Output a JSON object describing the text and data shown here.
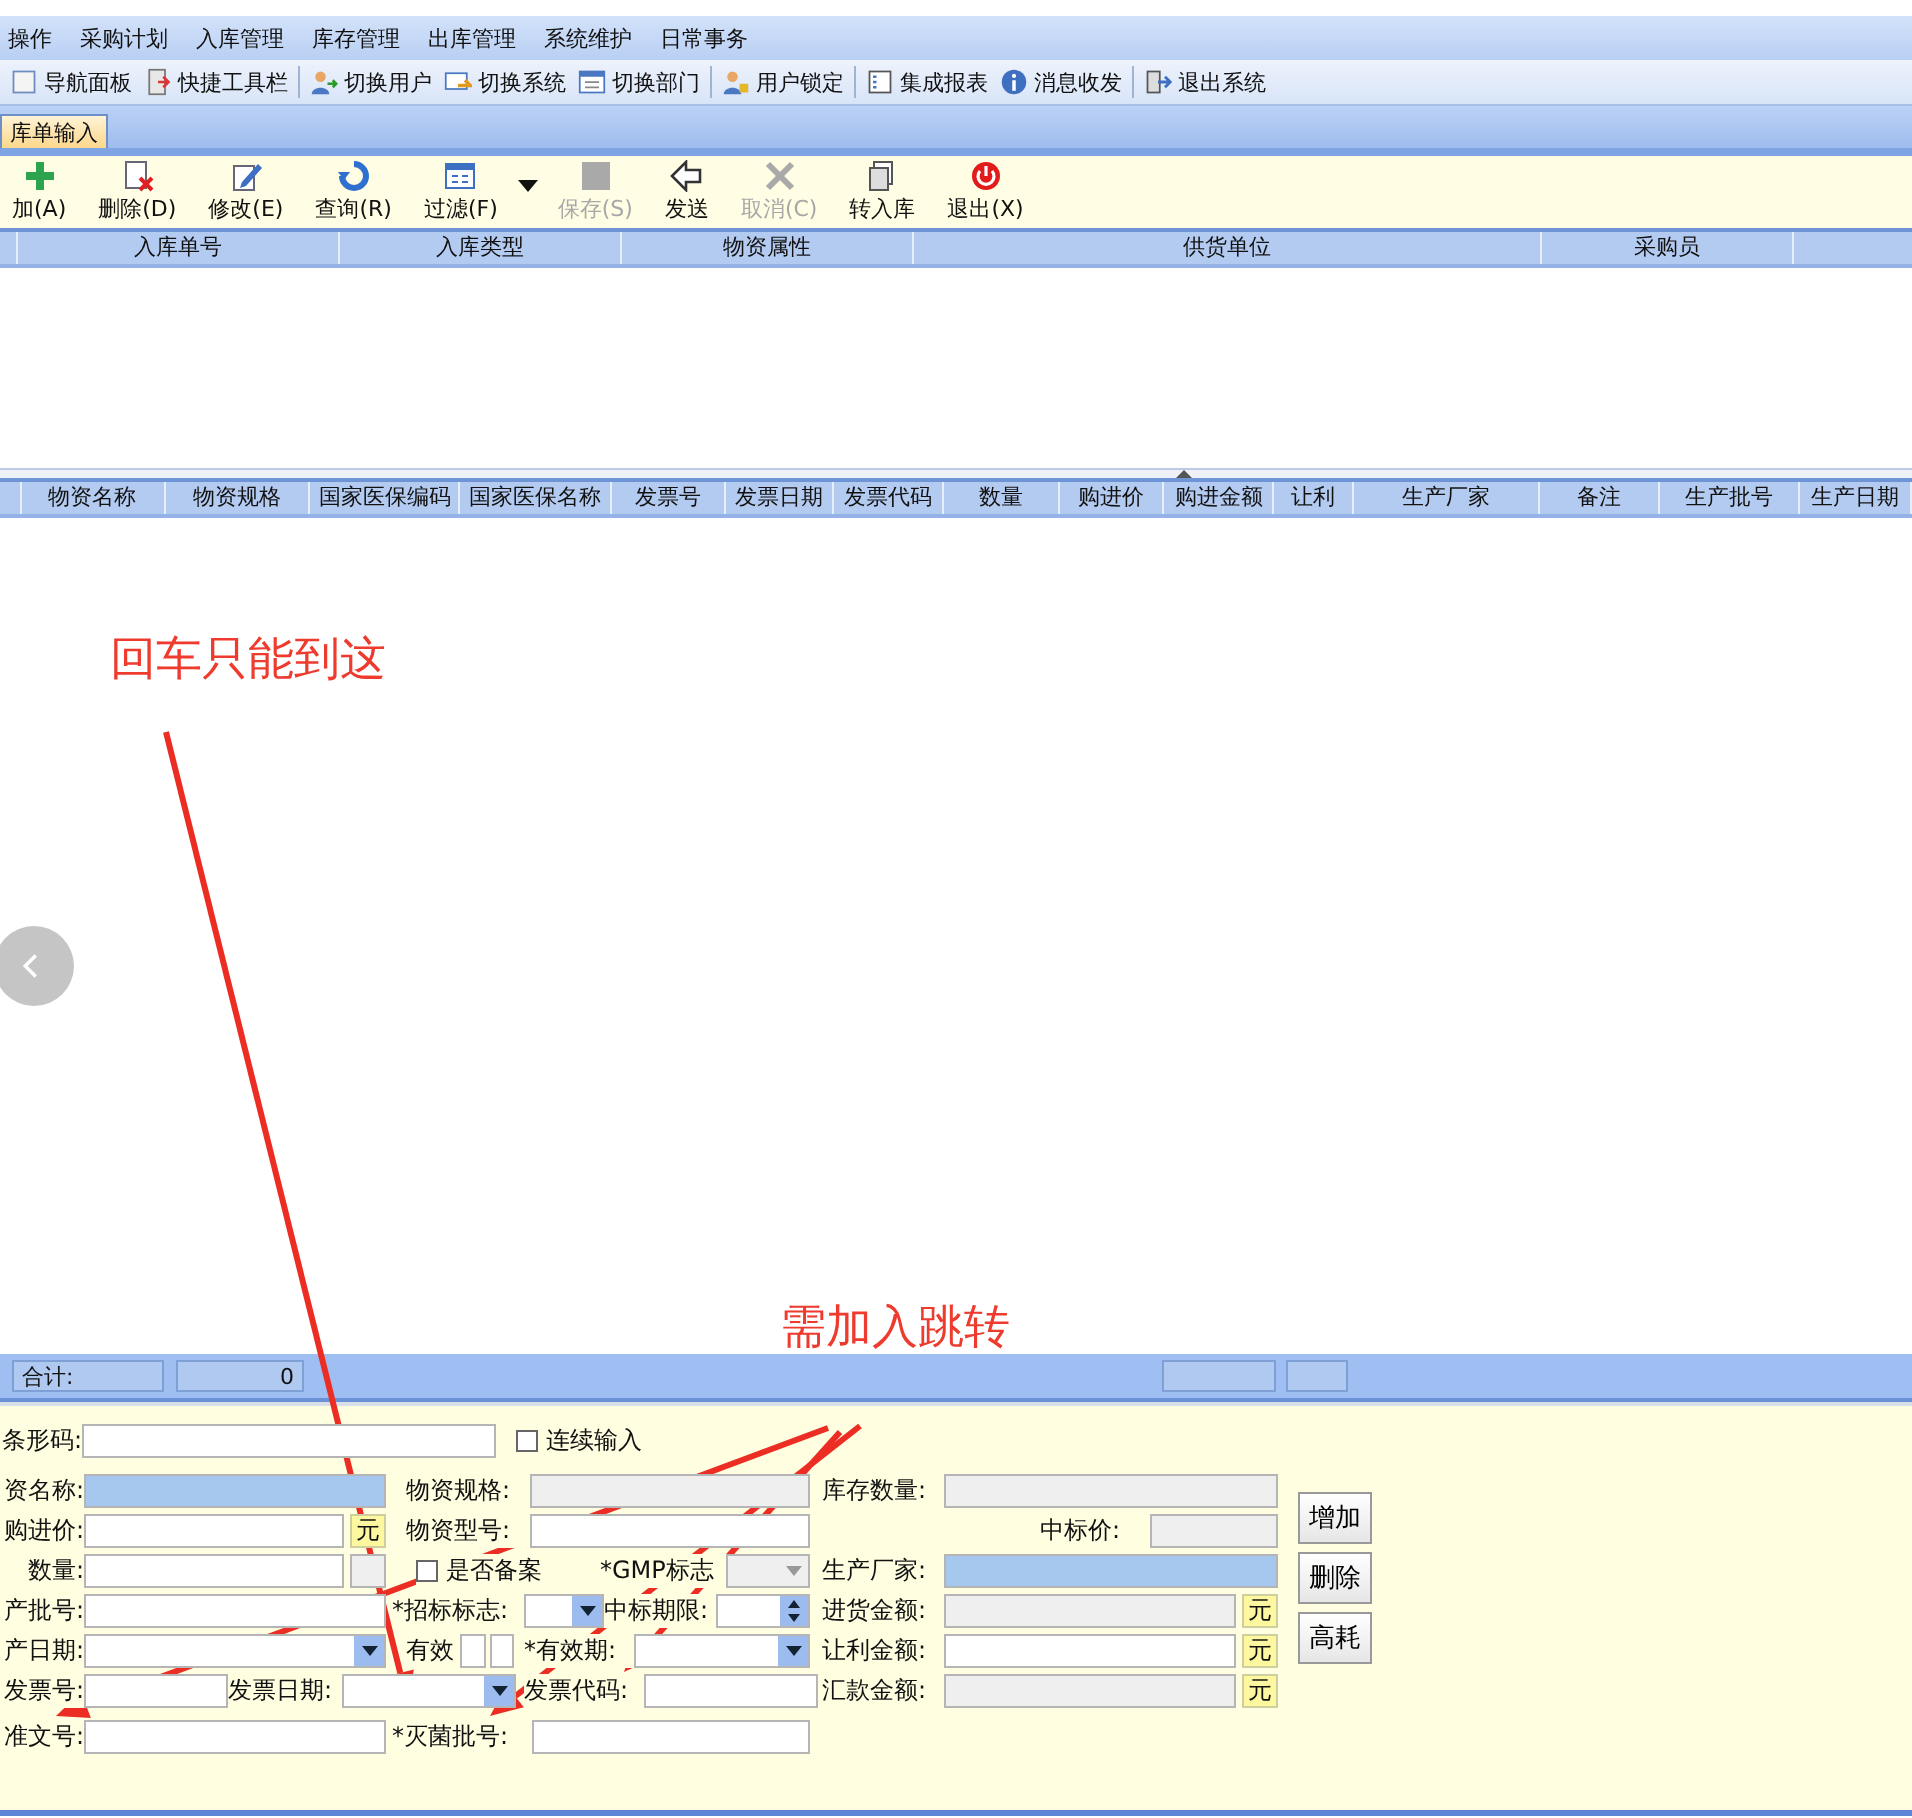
{
  "menu": [
    "操作",
    "采购计划",
    "入库管理",
    "库存管理",
    "出库管理",
    "系统维护",
    "日常事务"
  ],
  "quick_toolbar": [
    "导航面板",
    "快捷工具栏",
    "切换用户",
    "切换系统",
    "切换部门",
    "用户锁定",
    "集成报表",
    "消息收发",
    "退出系统"
  ],
  "tabs": [
    {
      "label": "库单输入",
      "selected": true
    }
  ],
  "toolbar": [
    {
      "kind": "button",
      "label": "加(A)",
      "disabled": false
    },
    {
      "kind": "button",
      "label": "删除(D)",
      "disabled": false
    },
    {
      "kind": "button",
      "label": "修改(E)",
      "disabled": false
    },
    {
      "kind": "button",
      "label": "查询(R)",
      "disabled": false
    },
    {
      "kind": "button",
      "label": "过滤(F)",
      "disabled": false
    },
    {
      "kind": "dropdown"
    },
    {
      "kind": "button",
      "label": "保存(S)",
      "disabled": true
    },
    {
      "kind": "button",
      "label": "发送",
      "disabled": false
    },
    {
      "kind": "button",
      "label": "取消(C)",
      "disabled": true
    },
    {
      "kind": "button",
      "label": "转入库",
      "disabled": false
    },
    {
      "kind": "button",
      "label": "退出(X)",
      "disabled": false
    }
  ],
  "master_table": {
    "columns": [
      "入库单号",
      "入库类型",
      "物资属性",
      "供货单位",
      "采购员"
    ]
  },
  "detail_table": {
    "columns": [
      "物资名称",
      "物资规格",
      "国家医保编码",
      "国家医保名称",
      "发票号",
      "发票日期",
      "发票代码",
      "数量",
      "购进价",
      "购进金额",
      "让利",
      "生产厂家",
      "备注",
      "生产批号",
      "生产日期"
    ]
  },
  "status_bar": {
    "total_label": "合计:",
    "total_value": "0"
  },
  "form": {
    "lines": [
      [
        {
          "kind": "label",
          "text": "条形码:"
        },
        {
          "kind": "input",
          "disabled": false,
          "highlighted": false
        },
        {
          "kind": "checkbox",
          "text": "连续输入",
          "checked": false
        }
      ],
      [
        {
          "kind": "label",
          "text": "资名称:"
        },
        {
          "kind": "input",
          "disabled": false,
          "highlighted": true
        },
        {
          "kind": "label",
          "text": "物资规格:"
        },
        {
          "kind": "input",
          "disabled": true,
          "highlighted": false
        },
        {
          "kind": "label",
          "text": "库存数量:"
        },
        {
          "kind": "input",
          "disabled": true,
          "highlighted": false
        }
      ],
      [
        {
          "kind": "label",
          "text": "购进价:"
        },
        {
          "kind": "input",
          "disabled": false,
          "highlighted": false
        },
        {
          "kind": "unit",
          "text": "元"
        },
        {
          "kind": "label",
          "text": "物资型号:"
        },
        {
          "kind": "input",
          "disabled": false,
          "highlighted": false
        },
        {
          "kind": "label",
          "text": "中标价:"
        },
        {
          "kind": "input",
          "disabled": true,
          "highlighted": false
        }
      ],
      [
        {
          "kind": "label",
          "text": "数量:"
        },
        {
          "kind": "input",
          "disabled": false,
          "highlighted": false
        },
        {
          "kind": "input",
          "disabled": true,
          "highlighted": false
        },
        {
          "kind": "checkbox",
          "text": "是否备案",
          "checked": false
        },
        {
          "kind": "label",
          "text": "*GMP标志"
        },
        {
          "kind": "dropdown",
          "disabled": true
        },
        {
          "kind": "label",
          "text": "生产厂家:"
        },
        {
          "kind": "input",
          "disabled": false,
          "highlighted": true
        }
      ],
      [
        {
          "kind": "label",
          "text": "产批号:"
        },
        {
          "kind": "input",
          "disabled": false,
          "highlighted": false
        },
        {
          "kind": "label",
          "text": "*招标标志:"
        },
        {
          "kind": "dropdown",
          "disabled": false
        },
        {
          "kind": "label",
          "text": "中标期限:"
        },
        {
          "kind": "spinner"
        },
        {
          "kind": "label",
          "text": "进货金额:"
        },
        {
          "kind": "input",
          "disabled": true,
          "highlighted": false
        },
        {
          "kind": "unit",
          "text": "元"
        }
      ],
      [
        {
          "kind": "label",
          "text": "产日期:"
        },
        {
          "kind": "dropdown",
          "disabled": false
        },
        {
          "kind": "label",
          "text": "有效"
        },
        {
          "kind": "input",
          "disabled": false,
          "highlighted": false
        },
        {
          "kind": "input",
          "disabled": false,
          "highlighted": false
        },
        {
          "kind": "label",
          "text": "*有效期:"
        },
        {
          "kind": "dropdown",
          "disabled": false
        },
        {
          "kind": "label",
          "text": "让利金额:"
        },
        {
          "kind": "input",
          "disabled": false,
          "highlighted": false
        },
        {
          "kind": "unit",
          "text": "元"
        }
      ],
      [
        {
          "kind": "label",
          "text": "发票号:"
        },
        {
          "kind": "input",
          "disabled": false,
          "highlighted": false
        },
        {
          "kind": "label",
          "text": "发票日期:"
        },
        {
          "kind": "dropdown",
          "disabled": false
        },
        {
          "kind": "label",
          "text": "发票代码:"
        },
        {
          "kind": "input",
          "disabled": false,
          "highlighted": false
        },
        {
          "kind": "label",
          "text": "汇款金额:"
        },
        {
          "kind": "input",
          "disabled": true,
          "highlighted": false
        },
        {
          "kind": "unit",
          "text": "元"
        }
      ],
      [
        {
          "kind": "label",
          "text": "准文号:"
        },
        {
          "kind": "input",
          "disabled": false,
          "highlighted": false
        },
        {
          "kind": "label",
          "text": "*灭菌批号:"
        },
        {
          "kind": "input",
          "disabled": false,
          "highlighted": false
        }
      ]
    ]
  },
  "form_buttons": [
    "增加",
    "删除",
    "高耗"
  ],
  "annotations": [
    "回车只能到这",
    "需加入跳转"
  ]
}
